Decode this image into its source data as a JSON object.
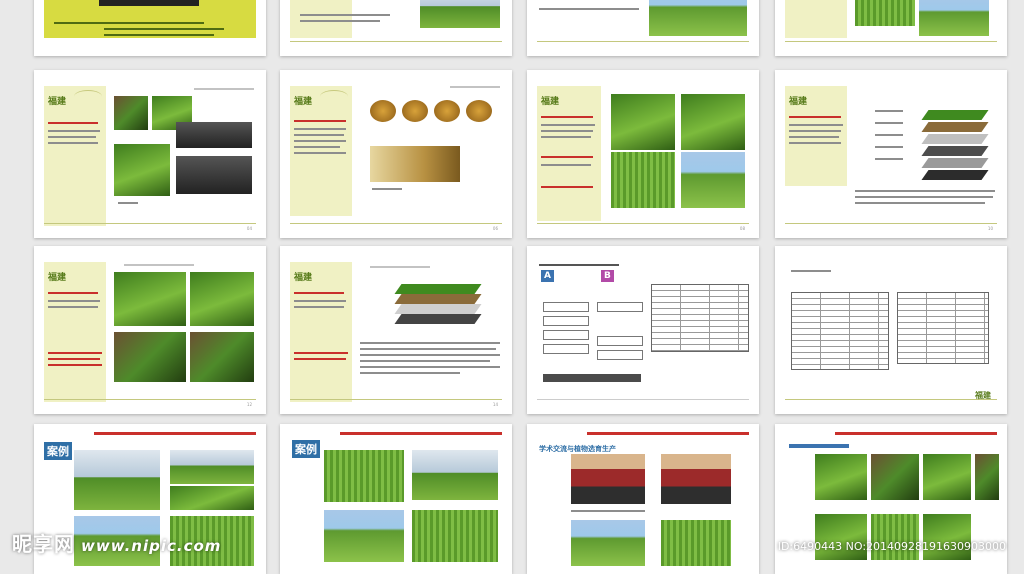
{
  "brand": {
    "logo_text": "福建",
    "accent_green": "#7cbb3c",
    "accent_red": "#c9302c",
    "sidebar_color": "#f0f1c4"
  },
  "pages": {
    "case_badge_1": "案例",
    "case_badge_2": "案例",
    "section_a": "A",
    "section_b": "B",
    "exchange_title": "学术交流与植物选育生产"
  },
  "watermark": {
    "site": "昵享网",
    "url": "www.nipic.com"
  },
  "image_id": "ID:6490443 NO:20140928191630903000"
}
